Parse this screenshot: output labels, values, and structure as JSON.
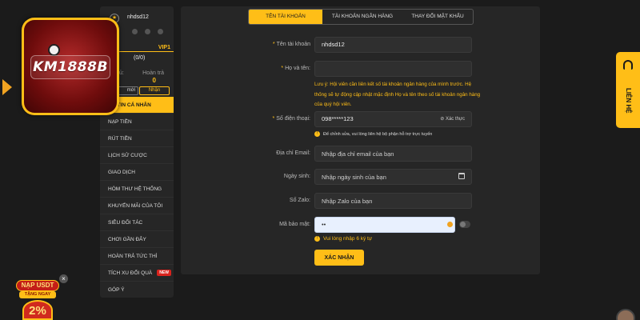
{
  "sidebar": {
    "username": "nhdsd12",
    "vip": "VIP1",
    "progress": "(0/0)",
    "ngay_label": "ủ:",
    "hoantra_label": "Hoàn trả",
    "hoantra_value": "0",
    "btn_moi": "mới",
    "btn_nhan": "Nhận",
    "new_badge": "NEW",
    "items": [
      {
        "label": "NG TIN CÁ NHÂN"
      },
      {
        "label": "NẠP TIỀN"
      },
      {
        "label": "RÚT TIỀN"
      },
      {
        "label": "LỊCH SỬ CƯỢC"
      },
      {
        "label": "GIAO DỊCH"
      },
      {
        "label": "HÒM THƯ HỆ THỐNG"
      },
      {
        "label": "KHUYẾN MÃI CỦA TÔI"
      },
      {
        "label": "SIÊU ĐỐI TÁC"
      },
      {
        "label": "CHƠI GẦN ĐÂY"
      },
      {
        "label": "HOÀN TRẢ TỨC THÌ"
      },
      {
        "label": "TÍCH XU ĐỔI QUÀ"
      },
      {
        "label": "GÓP Ý"
      }
    ]
  },
  "logo": {
    "text": "KM1888B"
  },
  "tabs": [
    {
      "label": "TÊN TÀI KHOẢN"
    },
    {
      "label": "TÀI KHOẢN NGÂN HÀNG"
    },
    {
      "label": "THAY ĐỔI MẬT KHẨU"
    }
  ],
  "form": {
    "required_mark": "*",
    "username": {
      "label": "Tên tài khoản",
      "value": "nhdsd12"
    },
    "fullname": {
      "label": "Họ và tên:",
      "value": ""
    },
    "note": "Lưu ý: Hội viên cần liên kết số tài khoản ngân hàng của mình trước. Hệ thống sẽ tự động cập nhật mặc định Họ và tên theo số tài khoản ngân hàng của quý hội viên.",
    "phone": {
      "label": "Số điện thoại:",
      "value": "098*****123",
      "action": "Xác thực"
    },
    "phone_hint": "Để chỉnh sửa, vui lòng liên hệ bộ phận hỗ trợ trực tuyến",
    "email": {
      "label": "Địa chỉ Email:",
      "placeholder": "Nhập địa chỉ email của bạn"
    },
    "birthday": {
      "label": "Ngày sinh:",
      "placeholder": "Nhập ngày sinh của bạn"
    },
    "zalo": {
      "label": "Số Zalo:",
      "placeholder": "Nhập Zalo của bạn"
    },
    "security": {
      "label": "Mã bảo mật:",
      "value": "••"
    },
    "security_hint": "Vui lòng nhập 6 ký tự",
    "submit": "XÁC NHẬN"
  },
  "contact": {
    "label": "LIÊN HỆ"
  },
  "promo": {
    "line1": "NẠP USDT",
    "line2": "TẶNG NGAY",
    "percent": "2%",
    "close": "×"
  },
  "colors": {
    "accent": "#ffbe17",
    "panel": "#262626",
    "background": "#1b1b1b",
    "danger": "#d9231d"
  }
}
